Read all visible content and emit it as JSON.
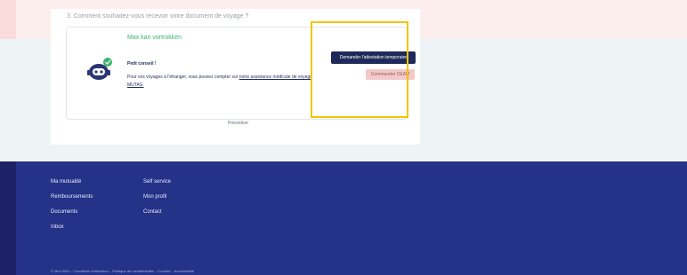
{
  "question": "3. Comment souhaitez-vous recevoir votre document de voyage ?",
  "voice_title": "Max kan vortrokken",
  "tip": {
    "title": "Petit conseil !",
    "text_before": "Pour vos voyages à l'étranger, vous pouvez compter sur ",
    "link_text": "notre assistance médicale de voyage MUTAS."
  },
  "buttons": {
    "primary": "Demander l'attestation temporaire",
    "secondary": "Commander CEAM"
  },
  "previous": "Précédent",
  "footer": {
    "col1": [
      "Ma mutualité",
      "Remboursements",
      "Documents",
      "Inbox"
    ],
    "col2": [
      "Self service",
      "Mon profil",
      "Contact"
    ],
    "bottom_text": "© Mut 2024 – Conditions d'utilisation – Politique de confidentialité – Cookies – Accessibilité"
  },
  "colors": {
    "accent_navy": "#1f2a5a",
    "footer_bg": "#243287",
    "highlight": "#f2c500",
    "green": "#3cb371"
  }
}
